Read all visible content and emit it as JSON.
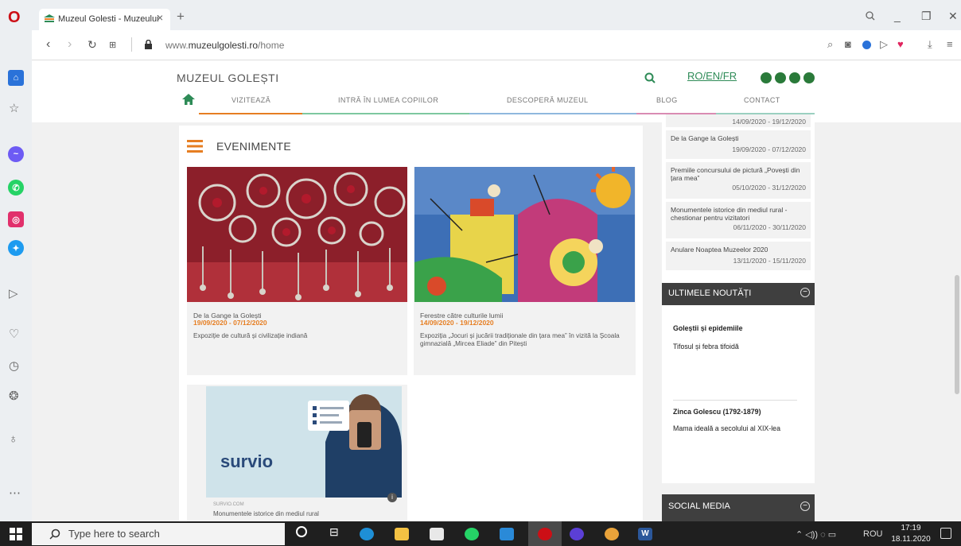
{
  "browser": {
    "tab_title": "Muzeul Golesti - Muzeului",
    "new_tab": "+",
    "close_tab": "×",
    "url_prefix": "www.",
    "url_domain": "muzeulgolesti.ro",
    "url_path": "/home"
  },
  "site": {
    "logo": "MUZEUL GOLEȘTI",
    "languages": "RO/EN/FR",
    "menu": [
      "VIZITEAZĂ",
      "INTRĂ ÎN LUMEA COPIILOR",
      "DESCOPERĂ MUZEUL",
      "BLOG",
      "CONTACT"
    ]
  },
  "events": {
    "heading": "EVENIMENTE",
    "cards": [
      {
        "title": "De la Gange la Golești",
        "dates": "19/09/2020 - 07/12/2020",
        "desc": "Expoziție de cultură și civilizație indiană"
      },
      {
        "title": "Ferestre către culturile lumii",
        "dates": "14/09/2020 - 19/12/2020",
        "desc": "Expoziția „Jocuri și jucării tradiționale din țara mea” în vizită la Școala gimnazială „Mircea Eliade” din Pitești"
      },
      {
        "brand": "survio",
        "source": "SURVIO.COM",
        "title": "Monumentele istorice din mediul rural"
      }
    ]
  },
  "sidebar_events": [
    {
      "title": "",
      "dates": "14/09/2020 - 19/12/2020"
    },
    {
      "title": "De la Gange la Golești",
      "dates": "19/09/2020 - 07/12/2020"
    },
    {
      "title": "Premiile concursului de pictură „Povești din țara mea”",
      "dates": "05/10/2020 - 31/12/2020"
    },
    {
      "title": "Monumentele istorice din mediul rural - chestionar pentru vizitatori",
      "dates": "06/11/2020 - 30/11/2020"
    },
    {
      "title": "Anulare Noaptea Muzeelor 2020",
      "dates": "13/11/2020 - 15/11/2020"
    }
  ],
  "news": {
    "heading": "ULTIMELE NOUTĂȚI",
    "items": [
      {
        "title": "Goleștii și epidemiile",
        "subtitle": "Tifosul și febra tifoidă"
      },
      {
        "title": "Zinca Golescu (1792-1879)",
        "subtitle": "Mama ideală a secolului al XIX-lea"
      }
    ]
  },
  "social_heading": "SOCIAL MEDIA",
  "taskbar": {
    "search_placeholder": "Type here to search",
    "language": "ROU",
    "time": "17:19",
    "date": "18.11.2020"
  },
  "colors": {
    "brand_green": "#2e8b57",
    "date_orange": "#e67e22",
    "dark_panel": "#3f3f3f",
    "opera_red": "#cc0f16"
  }
}
